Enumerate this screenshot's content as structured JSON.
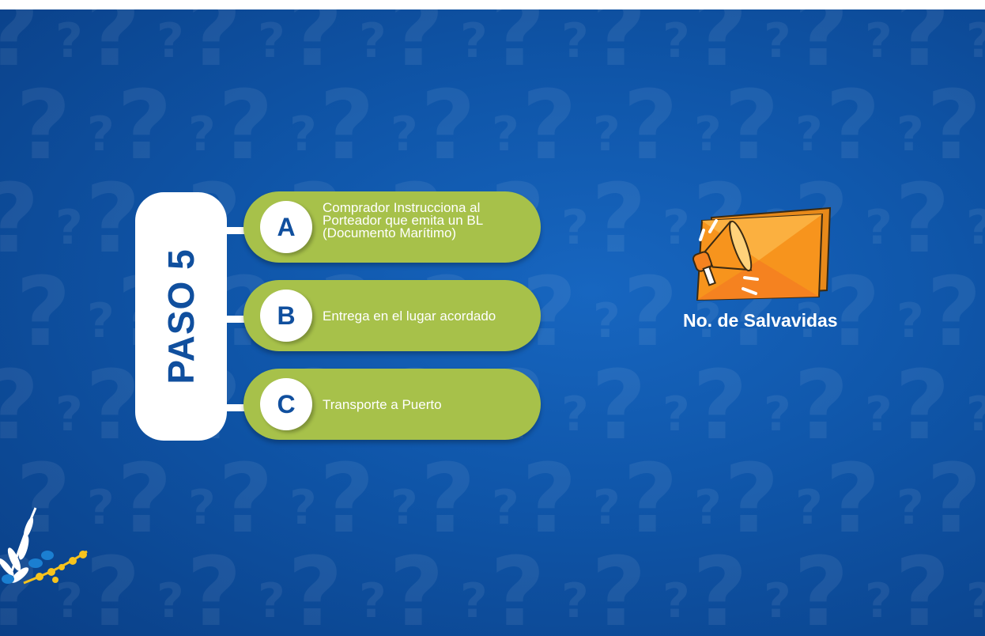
{
  "step": {
    "label": "PASO 5"
  },
  "options": [
    {
      "letter": "A",
      "text_lines": [
        "Comprador Instrucciona al",
        "Porteador que emita un BL",
        "(Documento Marítimo)"
      ]
    },
    {
      "letter": "B",
      "text": "Entrega en el lugar acordado"
    },
    {
      "letter": "C",
      "text": "Transporte a Puerto"
    }
  ],
  "lifelines": {
    "title": "No. de Salvavidas",
    "icon": "megaphone-icon"
  },
  "colors": {
    "background": "#0f55a8",
    "pill": "#a7c14a",
    "accent_blue": "#104f9e",
    "icon_orange": "#f7941d"
  }
}
